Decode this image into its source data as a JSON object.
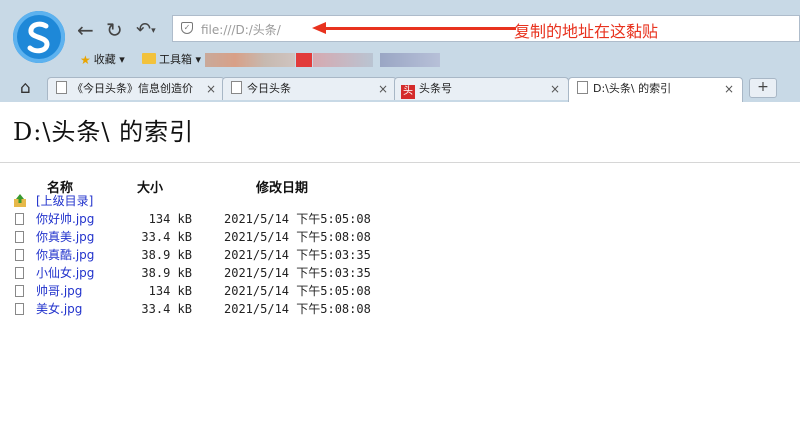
{
  "browser": {
    "address": "file:///D:/头条/",
    "annotation": "复制的地址在这黏贴",
    "bookmarks": [
      {
        "label": "收藏 ▾"
      },
      {
        "label": "工具箱 ▾"
      }
    ],
    "tabs": [
      {
        "label": "《今日头条》信息创造价",
        "active": false
      },
      {
        "label": "今日头条",
        "active": false
      },
      {
        "label": "头条号",
        "active": false
      },
      {
        "label": "D:\\头条\\ 的索引",
        "active": true
      }
    ],
    "tab_close": "×",
    "new_tab": "+",
    "colors": {
      "annotation": "#e8321e",
      "link": "#2233cc",
      "chrome": "#c8d9e6"
    }
  },
  "page": {
    "title": "D:\\头条\\ 的索引",
    "columns": {
      "name": "名称",
      "size": "大小",
      "modified": "修改日期"
    },
    "parent_link": "[上级目录]",
    "files": [
      {
        "name": "你好帅.jpg",
        "size": "134 kB",
        "date": "2021/5/14 下午5:05:08"
      },
      {
        "name": "你真美.jpg",
        "size": "33.4 kB",
        "date": "2021/5/14 下午5:08:08"
      },
      {
        "name": "你真酷.jpg",
        "size": "38.9 kB",
        "date": "2021/5/14 下午5:03:35"
      },
      {
        "name": "小仙女.jpg",
        "size": "38.9 kB",
        "date": "2021/5/14 下午5:03:35"
      },
      {
        "name": "帅哥.jpg",
        "size": "134 kB",
        "date": "2021/5/14 下午5:05:08"
      },
      {
        "name": "美女.jpg",
        "size": "33.4 kB",
        "date": "2021/5/14 下午5:08:08"
      }
    ]
  }
}
